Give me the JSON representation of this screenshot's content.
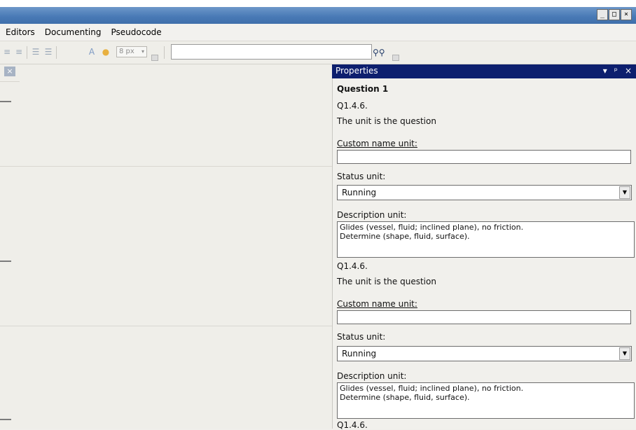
{
  "window": {
    "minimize_glyph": "_",
    "maximize_glyph": "□",
    "close_glyph": "×"
  },
  "menu": {
    "items": [
      "Editors",
      "Documenting",
      "Pseudocode"
    ]
  },
  "toolbar": {
    "font_size_value": "8 px",
    "search_value": ""
  },
  "icons": {
    "find": "binoculars-icon",
    "left_close": "close-icon"
  },
  "properties": {
    "title": "Properties",
    "pin_glyph": "▾",
    "autohide_glyph": "ᵖ",
    "close_glyph": "×",
    "heading": "Question 1",
    "groups": [
      {
        "code": "Q1.4.6.",
        "summary": "The unit is the question",
        "custom_name_label": "Custom name unit:",
        "custom_name_value": "",
        "status_label": "Status unit:",
        "status_value": "Running",
        "description_label": "Description unit:",
        "description_lines": [
          "Glides (vessel, fluid; inclined plane), no friction.",
          "Determine (shape, fluid, surface)."
        ]
      },
      {
        "code": "Q1.4.6.",
        "summary": "The unit is the question",
        "custom_name_label": "Custom name unit:",
        "custom_name_value": "",
        "status_label": "Status unit:",
        "status_value": "Running",
        "description_label": "Description unit:",
        "description_lines": [
          "Glides (vessel, fluid; inclined plane), no friction.",
          "Determine (shape, fluid, surface)."
        ]
      }
    ],
    "next_code": "Q1.4.6."
  },
  "colors": {
    "properties_header": "#0d1f6e",
    "titlebar": "#4a7bb7"
  }
}
